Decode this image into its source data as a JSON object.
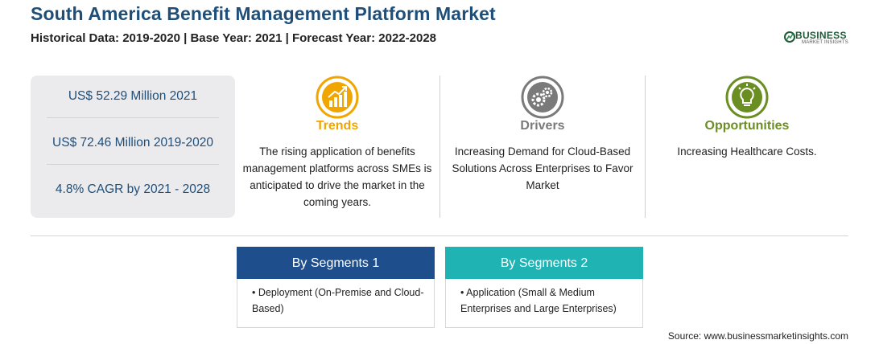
{
  "header": {
    "title": "South America Benefit Management Platform Market",
    "subtitle": "Historical Data: 2019-2020 | Base Year: 2021 | Forecast Year: 2022-2028"
  },
  "logo": {
    "brand": "BUSINESS",
    "tagline": "MARKET INSIGHTS"
  },
  "stats": [
    {
      "text": "US$ 52.29 Million 2021"
    },
    {
      "text": "US$ 72.46 Million 2019-2020"
    },
    {
      "text": "4.8% CAGR by 2021 - 2028"
    }
  ],
  "columns": [
    {
      "heading": "Trends",
      "icon": "trend-chart-icon",
      "color": "#f0a500",
      "body": "The rising application of benefits management platforms across SMEs is anticipated to drive the market in the coming years."
    },
    {
      "heading": "Drivers",
      "icon": "gears-icon",
      "color": "#7a7a7a",
      "body": "Increasing Demand for Cloud-Based Solutions Across Enterprises to Favor Market"
    },
    {
      "heading": "Opportunities",
      "icon": "lightbulb-icon",
      "color": "#6b8e23",
      "body": "Increasing Healthcare Costs."
    }
  ],
  "segments": [
    {
      "title": "By Segments 1",
      "color": "#1f4e8c",
      "item": "Deployment (On-Premise and Cloud-Based)"
    },
    {
      "title": "By Segments 2",
      "color": "#1fb3b3",
      "item": "Application (Small & Medium Enterprises and Large Enterprises)"
    }
  ],
  "source": "Source: www.businessmarketinsights.com"
}
